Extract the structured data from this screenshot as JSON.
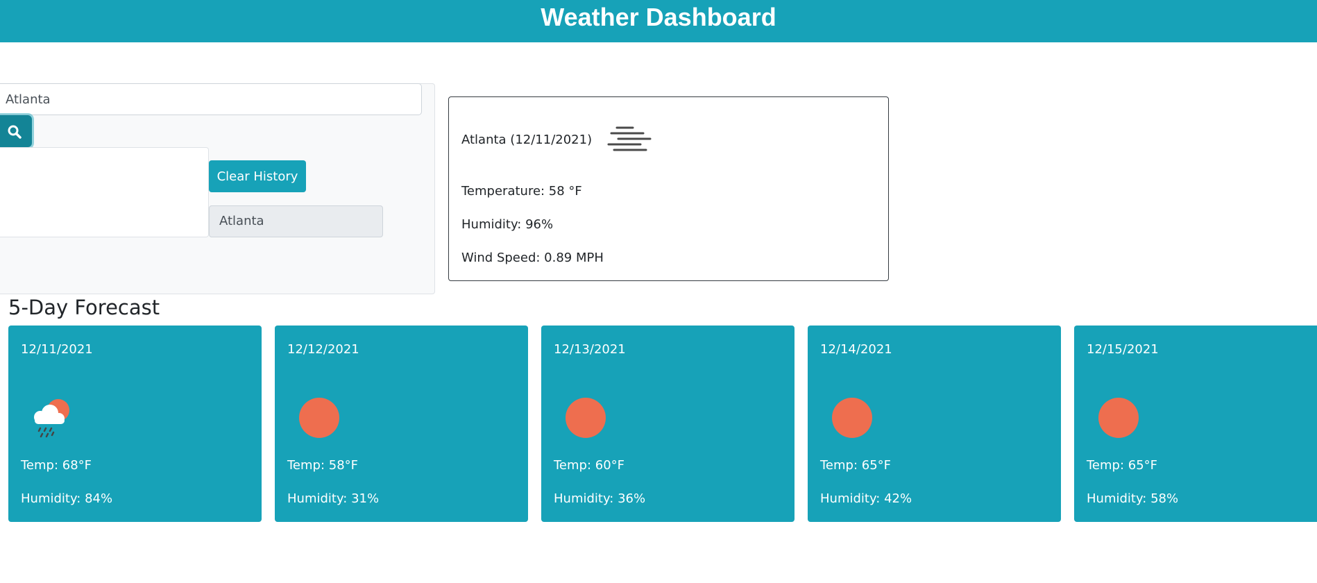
{
  "header": {
    "title": "Weather Dashboard"
  },
  "search": {
    "value": "Atlanta",
    "button_icon": "search-icon"
  },
  "history": {
    "clear_label": "Clear History",
    "items": [
      {
        "label": "Atlanta"
      }
    ]
  },
  "current": {
    "title": "Atlanta (12/11/2021)",
    "icon": "mist-icon",
    "temperature": "Temperature: 58 °F",
    "humidity": "Humidity: 96%",
    "wind": "Wind Speed: 0.89 MPH"
  },
  "forecast": {
    "title": "5-Day Forecast",
    "days": [
      {
        "date": "12/11/2021",
        "icon": "rain-sun-icon",
        "temp": "Temp: 68°F",
        "humidity": "Humidity: 84%"
      },
      {
        "date": "12/12/2021",
        "icon": "sun-icon",
        "temp": "Temp: 58°F",
        "humidity": "Humidity: 31%"
      },
      {
        "date": "12/13/2021",
        "icon": "sun-icon",
        "temp": "Temp: 60°F",
        "humidity": "Humidity: 36%"
      },
      {
        "date": "12/14/2021",
        "icon": "sun-icon",
        "temp": "Temp: 65°F",
        "humidity": "Humidity: 42%"
      },
      {
        "date": "12/15/2021",
        "icon": "sun-icon",
        "temp": "Temp: 65°F",
        "humidity": "Humidity: 58%"
      }
    ]
  },
  "colors": {
    "accent": "#17a2b8",
    "accent_dark": "#138496",
    "sun": "#ee6e4f"
  }
}
